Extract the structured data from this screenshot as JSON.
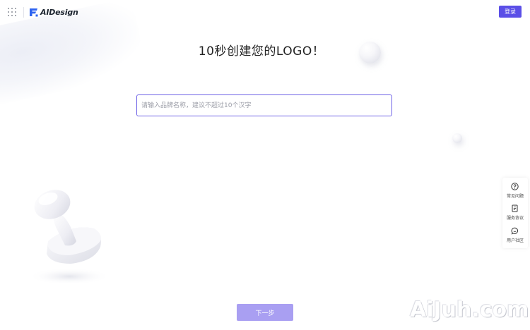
{
  "header": {
    "app_name": "AIDesign",
    "login_label": "登录",
    "brand_color": "#5b4fe7"
  },
  "main": {
    "headline": "10秒创建您的LOGO！",
    "brand_input": {
      "value": "",
      "placeholder": "请输入品牌名称，建议不超过10个汉字"
    },
    "next_label": "下一步"
  },
  "side_panel": {
    "items": [
      {
        "label": "常见问题",
        "icon": "question-circle-icon"
      },
      {
        "label": "服务协议",
        "icon": "document-icon"
      },
      {
        "label": "用户社区",
        "icon": "chat-bubble-icon"
      }
    ]
  },
  "watermark": "AiJuh.com"
}
